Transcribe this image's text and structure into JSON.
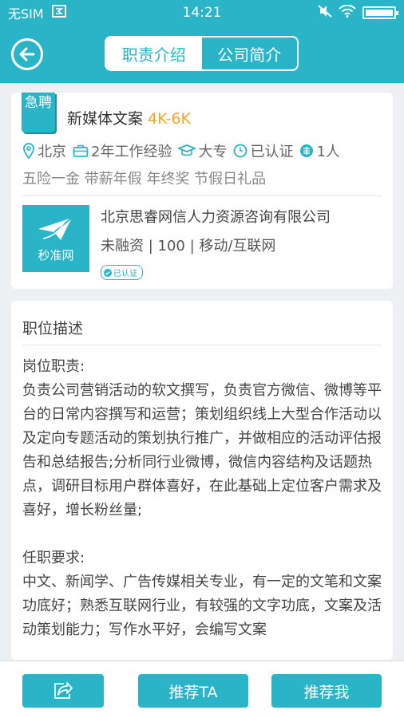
{
  "status_bar": {
    "carrier": "无SIM",
    "time": "14:21"
  },
  "header": {
    "tabs": [
      {
        "label": "职责介绍",
        "active": true
      },
      {
        "label": "公司简介",
        "active": false
      }
    ]
  },
  "job": {
    "urgent_tag": "急聘",
    "title": "新媒体文案",
    "salary": "4K-6K",
    "location": "北京",
    "experience": "2年工作经验",
    "education": "大专",
    "status": "已认证",
    "headcount": "1人",
    "benefits": "五险一金 带薪年假 年终奖 节假日礼品"
  },
  "company": {
    "logo_text": "秒准网",
    "name": "北京思睿网信人力资源咨询有限公司",
    "info": "未融资 | 100 | 移动/互联网",
    "verified": "已认证"
  },
  "description": {
    "title": "职位描述",
    "body": "岗位职责:\n负责公司营销活动的软文撰写，负责官方微信、微博等平台的日常内容撰写和运营；策划组织线上大型合作活动以及定向专题活动的策划执行推广，并做相应的活动评估报告和总结报告;分析同行业微博，微信内容结构及话题热点，调研目标用户群体喜好，在此基础上定位客户需求及喜好，增长粉丝量;\n\n任职要求:\n中文、新闻学、广告传媒相关专业，有一定的文笔和文案功底好；熟悉互联网行业，有较强的文字功底，文案及活动策划能力；写作水平好，会编写文案"
  },
  "bottom": {
    "recommend_label": "推荐TA",
    "self_label": "推荐我"
  },
  "colors": {
    "primary": "#29b4c8",
    "salary": "#f5a623"
  }
}
